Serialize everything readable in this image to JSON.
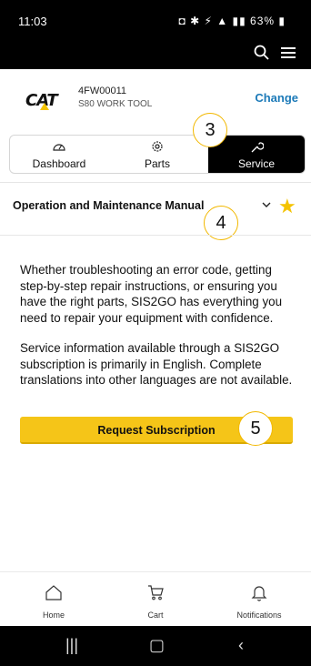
{
  "status_bar": {
    "time": "11:03",
    "battery": "63%"
  },
  "machine": {
    "brand": "CAT",
    "serial": "4FW00011",
    "model": "S80 WORK TOOL",
    "change_label": "Change"
  },
  "tabs": [
    {
      "label": "Dashboard",
      "icon": "gauge-icon"
    },
    {
      "label": "Parts",
      "icon": "gear-icon"
    },
    {
      "label": "Service",
      "icon": "wrench-icon"
    }
  ],
  "manual": {
    "title": "Operation and Maintenance Manual"
  },
  "content": {
    "p1": "Whether troubleshooting an error code, getting step-by-step repair instructions, or ensuring you have the right parts, SIS2GO has everything you need to repair your equipment with confidence.",
    "p2": "Service information available through a SIS2GO subscription is primarily in English. Complete translations into other languages are not available."
  },
  "request_button": "Request Subscription",
  "callouts": {
    "c3": "3",
    "c4": "4",
    "c5": "5"
  },
  "bottom_nav": [
    {
      "label": "Home",
      "icon": "home-icon"
    },
    {
      "label": "Cart",
      "icon": "cart-icon"
    },
    {
      "label": "Notifications",
      "icon": "bell-icon"
    }
  ],
  "colors": {
    "accent": "#f5c518",
    "link": "#1c7ab8",
    "active_tab": "#000000"
  }
}
